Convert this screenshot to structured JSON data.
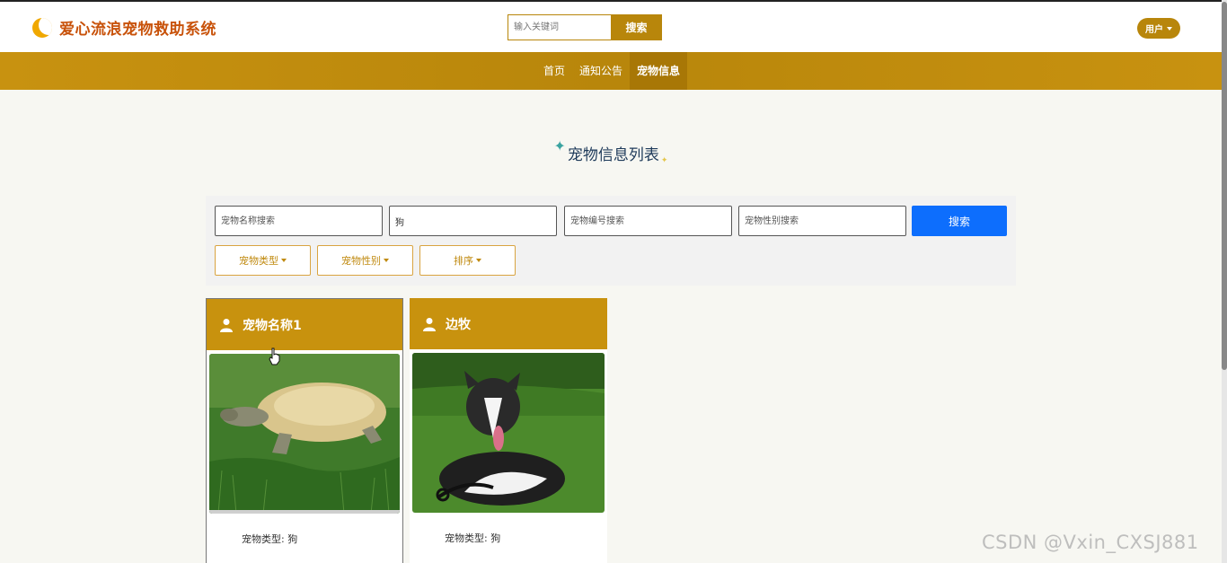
{
  "header": {
    "brand": "爱心流浪宠物救助系统",
    "search_placeholder": "输入关键词",
    "search_button": "搜索",
    "user_menu": "用户"
  },
  "nav": {
    "items": [
      {
        "label": "首页",
        "active": false
      },
      {
        "label": "通知公告",
        "active": false
      },
      {
        "label": "宠物信息",
        "active": true
      }
    ]
  },
  "section": {
    "title": "宠物信息列表"
  },
  "filters": {
    "name_placeholder": "宠物名称搜索",
    "type_value": "狗",
    "code_placeholder": "宠物编号搜索",
    "gender_placeholder": "宠物性别搜索",
    "search_button": "搜索",
    "dropdowns": [
      "宠物类型",
      "宠物性别",
      "排序"
    ]
  },
  "cards": [
    {
      "name": "宠物名称1",
      "type_label": "宠物类型:",
      "type_value": "狗"
    },
    {
      "name": "边牧",
      "type_label": "宠物类型:",
      "type_value": "狗"
    }
  ],
  "watermark": "CSDN @Vxin_CXSJ881",
  "colors": {
    "brand_text": "#c8520a",
    "gold": "#b8860b",
    "primary_button": "#0d6efd",
    "page_background": "#f7f7f2"
  }
}
